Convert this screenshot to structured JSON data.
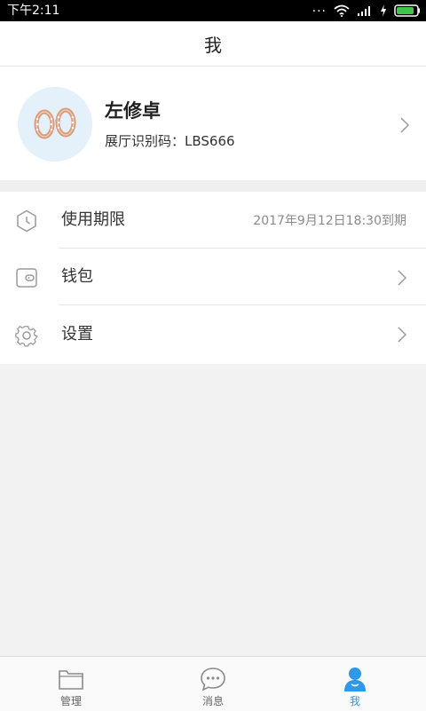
{
  "status_bar": {
    "time": "下午2:11",
    "dots": "..."
  },
  "header": {
    "title": "我"
  },
  "profile": {
    "name": "左修卓",
    "code_label": "展厅识别码：",
    "code_value": "LBS666",
    "avatar_icon": "earrings-photo"
  },
  "menu": [
    {
      "icon": "clock-icon",
      "label": "使用期限",
      "value": "2017年9月12日18:30到期"
    },
    {
      "icon": "wallet-icon",
      "label": "钱包"
    },
    {
      "icon": "gear-icon",
      "label": "设置"
    }
  ],
  "tabs": [
    {
      "icon": "folder-icon",
      "label": "管理",
      "active": false
    },
    {
      "icon": "chat-icon",
      "label": "消息",
      "active": false
    },
    {
      "icon": "person-icon",
      "label": "我",
      "active": true
    }
  ],
  "colors": {
    "accent": "#2f98e8",
    "icon_gray": "#9a9a9a",
    "background": "#f2f2f2"
  }
}
